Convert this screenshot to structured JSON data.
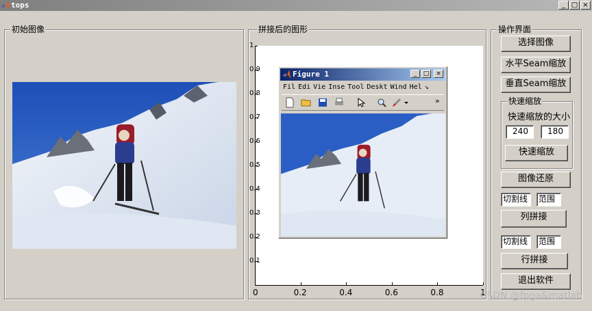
{
  "window": {
    "title": "tops",
    "controls": [
      "_",
      "□",
      "×"
    ]
  },
  "panels": {
    "original": {
      "title": "初始图像"
    },
    "stitched": {
      "title": "拼接后的图形"
    },
    "operations": {
      "title": "操作界面"
    }
  },
  "axes": {
    "x_ticks": [
      "0",
      "0.2",
      "0.4",
      "0.6",
      "0.8",
      "1"
    ],
    "y_ticks": [
      "1",
      "0.9",
      "0.8",
      "0.7",
      "0.6",
      "0.5",
      "0.4",
      "0.3",
      "0.2",
      "0.1"
    ]
  },
  "figure_window": {
    "title": "Figure 1",
    "menu": [
      "Fil",
      "Edi",
      "Vie",
      "Inse",
      "Tool",
      "Deskt",
      "Wind",
      "Hel",
      "↘"
    ],
    "toolbar": [
      "new-file",
      "open-folder",
      "save",
      "print",
      "pointer",
      "zoom",
      "brush",
      "dropdown",
      "more"
    ],
    "overflow": "»"
  },
  "operations": {
    "select_image": "选择图像",
    "horizontal_seam": "水平Seam缩放",
    "vertical_seam": "垂直Seam缩放",
    "quick_group_title": "快速缩放",
    "quick_size_label": "快速缩放的大小",
    "quick_width": "240",
    "quick_height": "180",
    "quick_scale": "快速缩放",
    "restore": "图像还原",
    "col_cut_line": "切割线",
    "col_range": "范围",
    "col_stitch": "列拼接",
    "row_cut_line": "切割线",
    "row_range": "范围",
    "row_stitch": "行拼接",
    "exit": "退出软件"
  },
  "watermark": "CSDN @fpga&matlab",
  "colors": {
    "window_bg": "#d4d0c8",
    "title_bar_inactive": "#808080",
    "figure_title_active": "#0a246a"
  }
}
